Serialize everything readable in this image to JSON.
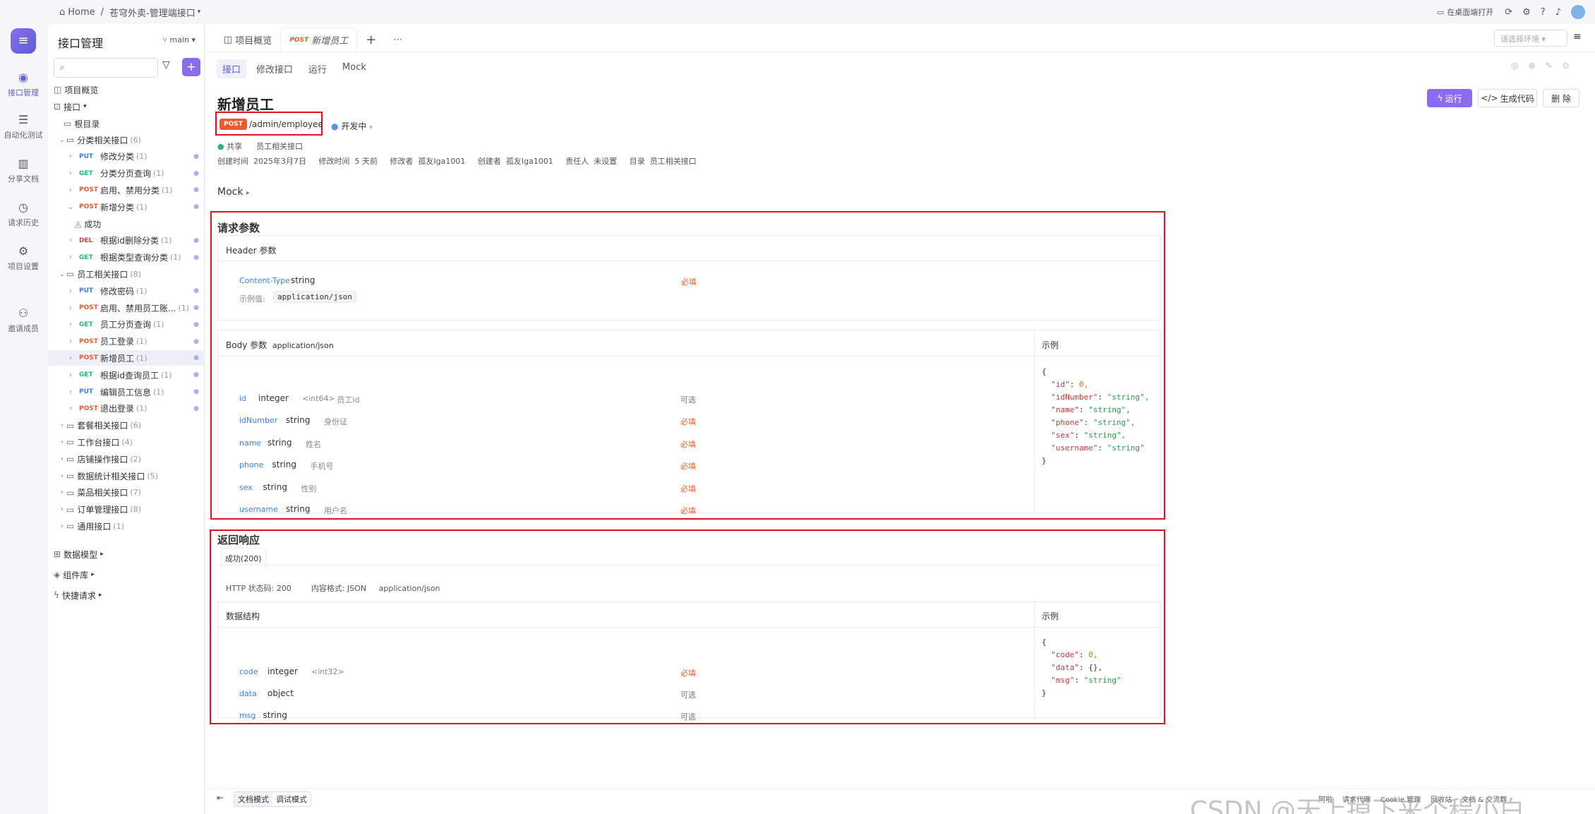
{
  "topbar": {
    "home": "Home",
    "sep": "/",
    "project": "苍穹外卖-管理端接口",
    "open_desktop": "在桌面端打开"
  },
  "rail": [
    {
      "icon": "api-icon",
      "label": "接口管理"
    },
    {
      "icon": "automation-icon",
      "label": "自动化测试"
    },
    {
      "icon": "book-icon",
      "label": "分享文档"
    },
    {
      "icon": "clock-icon",
      "label": "请求历史"
    },
    {
      "icon": "settings-icon",
      "label": "项目设置"
    },
    {
      "icon": "invite-icon",
      "label": "邀请成员"
    }
  ],
  "sidebar": {
    "title": "接口管理",
    "branch": "main",
    "overview": "项目概览",
    "interfaces": "接口",
    "root": "根目录",
    "tree": [
      {
        "type": "folder",
        "label": "分类相关接口",
        "count": "(6)",
        "open": true,
        "indent": 1
      },
      {
        "type": "api",
        "method": "PUT",
        "label": "修改分类",
        "count": "(1)",
        "indent": 2
      },
      {
        "type": "api",
        "method": "GET",
        "label": "分类分页查询",
        "count": "(1)",
        "indent": 2
      },
      {
        "type": "api",
        "method": "POST",
        "label": "启用、禁用分类",
        "count": "(1)",
        "indent": 2
      },
      {
        "type": "api",
        "method": "POST",
        "label": "新增分类",
        "count": "(1)",
        "indent": 2,
        "open": true
      },
      {
        "type": "case",
        "label": "成功",
        "indent": 3
      },
      {
        "type": "api",
        "method": "DEL",
        "label": "根据id删除分类",
        "count": "(1)",
        "indent": 2
      },
      {
        "type": "api",
        "method": "GET",
        "label": "根据类型查询分类",
        "count": "(1)",
        "indent": 2
      },
      {
        "type": "folder",
        "label": "员工相关接口",
        "count": "(8)",
        "open": true,
        "indent": 1
      },
      {
        "type": "api",
        "method": "PUT",
        "label": "修改密码",
        "count": "(1)",
        "indent": 2
      },
      {
        "type": "api",
        "method": "POST",
        "label": "启用、禁用员工账...",
        "count": "(1)",
        "indent": 2
      },
      {
        "type": "api",
        "method": "GET",
        "label": "员工分页查询",
        "count": "(1)",
        "indent": 2
      },
      {
        "type": "api",
        "method": "POST",
        "label": "员工登录",
        "count": "(1)",
        "indent": 2
      },
      {
        "type": "api",
        "method": "POST",
        "label": "新增员工",
        "count": "(1)",
        "indent": 2,
        "selected": true
      },
      {
        "type": "api",
        "method": "GET",
        "label": "根据id查询员工",
        "count": "(1)",
        "indent": 2
      },
      {
        "type": "api",
        "method": "PUT",
        "label": "编辑员工信息",
        "count": "(1)",
        "indent": 2
      },
      {
        "type": "api",
        "method": "POST",
        "label": "退出登录",
        "count": "(1)",
        "indent": 2
      },
      {
        "type": "folder",
        "label": "套餐相关接口",
        "count": "(6)",
        "indent": 1
      },
      {
        "type": "folder",
        "label": "工作台接口",
        "count": "(4)",
        "indent": 1
      },
      {
        "type": "folder",
        "label": "店铺操作接口",
        "count": "(2)",
        "indent": 1
      },
      {
        "type": "folder",
        "label": "数据统计相关接口",
        "count": "(5)",
        "indent": 1
      },
      {
        "type": "folder",
        "label": "菜品相关接口",
        "count": "(7)",
        "indent": 1
      },
      {
        "type": "folder",
        "label": "订单管理接口",
        "count": "(8)",
        "indent": 1
      },
      {
        "type": "folder",
        "label": "通用接口",
        "count": "(1)",
        "indent": 1
      }
    ],
    "bottom": [
      "数据模型",
      "组件库",
      "快捷请求"
    ]
  },
  "tabs": {
    "overview": "项目概览",
    "current_method": "POST",
    "current": "新增员工",
    "env_placeholder": "请选择环境"
  },
  "subtabs": [
    "接口",
    "修改接口",
    "运行",
    "Mock"
  ],
  "api": {
    "title": "新增员工",
    "method": "POST",
    "path": "/admin/employee",
    "status": "开发中",
    "share": "共享",
    "folder_tag": "员工相关接口",
    "meta": "创建时间  2025年3月7日     修改时间  5 天前     修改者  孤友Iga1001     创建者  孤友Iga1001     责任人  未设置     目录  员工相关接口",
    "run": "运行",
    "gen_code": "生成代码",
    "delete": "删 除",
    "mock": "Mock"
  },
  "request": {
    "title": "请求参数",
    "header_title": "Header 参数",
    "header": {
      "name": "Content-Type",
      "type": "string",
      "req": "必填",
      "example_label": "示例值:",
      "example": "application/json"
    },
    "body_title": "Body 参数",
    "body_type": "application/json",
    "example_title": "示例",
    "fields": [
      {
        "name": "id",
        "type": "integer",
        "fmt": "<int64>",
        "desc": "员工id",
        "req": "可选",
        "required": false
      },
      {
        "name": "idNumber",
        "type": "string",
        "fmt": "",
        "desc": "身份证",
        "req": "必填",
        "required": true
      },
      {
        "name": "name",
        "type": "string",
        "fmt": "",
        "desc": "姓名",
        "req": "必填",
        "required": true
      },
      {
        "name": "phone",
        "type": "string",
        "fmt": "",
        "desc": "手机号",
        "req": "必填",
        "required": true
      },
      {
        "name": "sex",
        "type": "string",
        "fmt": "",
        "desc": "性别",
        "req": "必填",
        "required": true
      },
      {
        "name": "username",
        "type": "string",
        "fmt": "",
        "desc": "用户名",
        "req": "必填",
        "required": true
      }
    ],
    "example_lines": [
      "{",
      "  \"id\": 0,",
      "  \"idNumber\": \"string\",",
      "  \"name\": \"string\",",
      "  \"phone\": \"string\",",
      "  \"sex\": \"string\",",
      "  \"username\": \"string\"",
      "}"
    ]
  },
  "response": {
    "title": "返回响应",
    "tab": "成功(200)",
    "meta": "HTTP 状态码: 200        内容格式: JSON     application/json",
    "struct_title": "数据结构",
    "example_title": "示例",
    "fields": [
      {
        "name": "code",
        "type": "integer",
        "fmt": "<int32>",
        "req": "必填"
      },
      {
        "name": "data",
        "type": "object",
        "fmt": "",
        "req": "可选"
      },
      {
        "name": "msg",
        "type": "string",
        "fmt": "",
        "req": "可选"
      }
    ],
    "example_lines": [
      "{",
      "  \"code\": 0,",
      "  \"data\": {},",
      "  \"msg\": \"string\"",
      "}"
    ]
  },
  "footer": {
    "doc_mode": "文档模式",
    "debug_mode": "调试模式",
    "items": [
      "阿啦",
      "请求代理",
      "Cookie 管理",
      "回收站",
      "文档 & 交流群"
    ],
    "watermark": "CSDN @天上掉下来个程小白"
  }
}
